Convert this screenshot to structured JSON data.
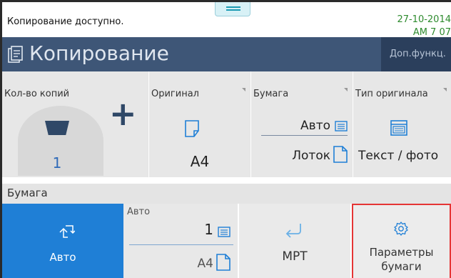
{
  "status": {
    "message": "Копирование доступно.",
    "date": "27-10-2014",
    "time": "AM 7 07"
  },
  "header": {
    "title": "Копирование",
    "more_button": "Доп.функц."
  },
  "settings": {
    "copies": {
      "label": "Кол-во копий",
      "value": "1"
    },
    "original": {
      "label": "Оригинал",
      "size": "A4"
    },
    "paper": {
      "label": "Бумага",
      "mode": "Авто",
      "source": "Лоток"
    },
    "original_type": {
      "label": "Тип оригинала",
      "value": "Текст / фото"
    }
  },
  "paper_section": {
    "label": "Бумага",
    "options": {
      "auto": {
        "label": "Авто"
      },
      "tray": {
        "caption": "Авто",
        "number": "1",
        "size": "A4"
      },
      "mpt": {
        "label": "МРТ"
      },
      "params": {
        "line1": "Параметры",
        "line2": "бумаги"
      }
    }
  },
  "colors": {
    "title_bar": "#3e5677",
    "selected": "#1f7fd6",
    "highlight_border": "#e53535",
    "status_green": "#2e8b2e"
  }
}
